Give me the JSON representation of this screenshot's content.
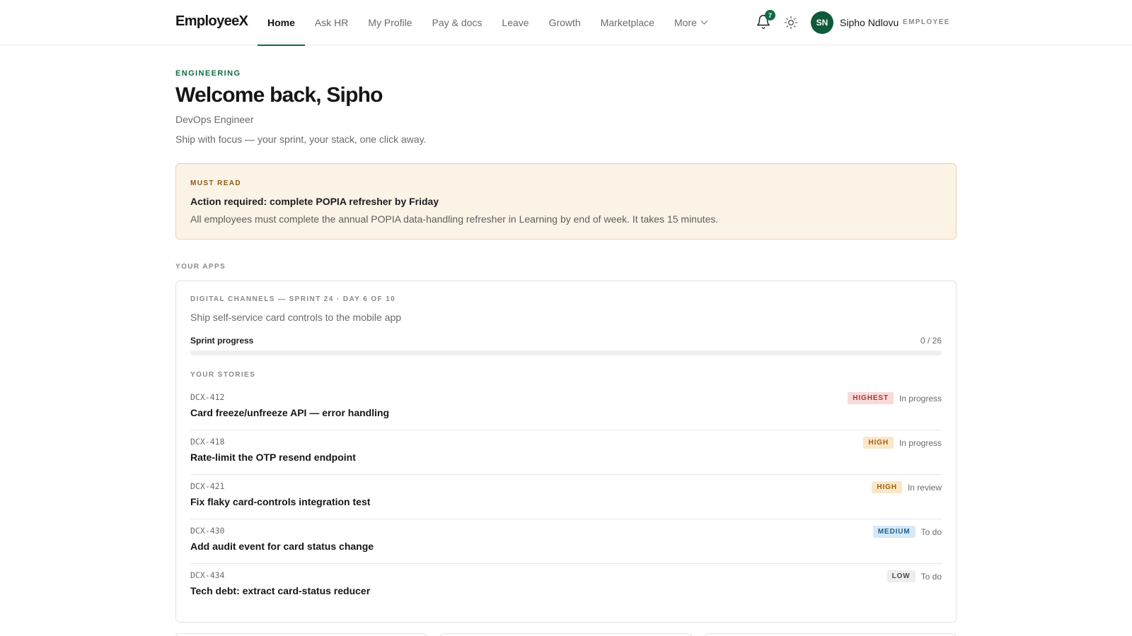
{
  "app": {
    "logo": "EmployeeX"
  },
  "nav": {
    "items": [
      {
        "label": "Home",
        "active": true
      },
      {
        "label": "Ask HR"
      },
      {
        "label": "My Profile"
      },
      {
        "label": "Pay & docs"
      },
      {
        "label": "Leave"
      },
      {
        "label": "Growth"
      },
      {
        "label": "Marketplace"
      },
      {
        "label": "More"
      }
    ],
    "notification_count": "7",
    "bell_icon": "bell-icon",
    "theme_icon": "sun-icon"
  },
  "user": {
    "initials": "SN",
    "name": "Sipho Ndlovu",
    "role": "EMPLOYEE",
    "avatar_color": "#0e5a3a"
  },
  "header": {
    "department": "ENGINEERING",
    "greeting": "Welcome back, Sipho",
    "job_title": "DevOps Engineer",
    "tagline": "Ship with focus — your sprint, your stack, one click away."
  },
  "banner": {
    "eyebrow": "MUST READ",
    "title": "Action required: complete POPIA refresher by Friday",
    "body": "All employees must complete the annual POPIA data-handling refresher in Learning by end of week. It takes 15 minutes."
  },
  "apps": {
    "section_label": "YOUR APPS",
    "sprint": {
      "label": "DIGITAL CHANNELS — SPRINT 24 · DAY 6 OF 10",
      "goal": "Ship self-service card controls to the mobile app",
      "progress_label": "Sprint progress",
      "progress_count": "0 / 26",
      "progress_fraction": 0,
      "stories_label": "YOUR STORIES",
      "stories": [
        {
          "key": "DCX-412",
          "title": "Card freeze/unfreeze API — error handling",
          "priority": "HIGHEST",
          "status": "In progress"
        },
        {
          "key": "DCX-418",
          "title": "Rate-limit the OTP resend endpoint",
          "priority": "HIGH",
          "status": "In progress"
        },
        {
          "key": "DCX-421",
          "title": "Fix flaky card-controls integration test",
          "priority": "HIGH",
          "status": "In review"
        },
        {
          "key": "DCX-430",
          "title": "Add audit event for card status change",
          "priority": "MEDIUM",
          "status": "To do"
        },
        {
          "key": "DCX-434",
          "title": "Tech debt: extract card-status reducer",
          "priority": "LOW",
          "status": "To do"
        }
      ]
    }
  },
  "colors": {
    "accent": "#0e6b43",
    "banner_bg": "#fcf3e7",
    "priority_highest": "#b13434",
    "priority_high": "#9a6110",
    "priority_medium": "#1f5f94",
    "priority_low": "#4a4a4a"
  }
}
